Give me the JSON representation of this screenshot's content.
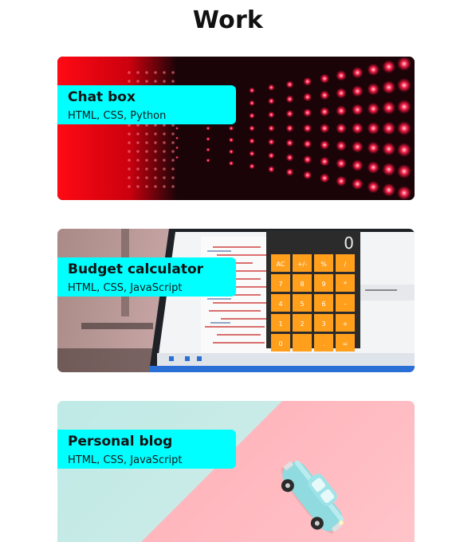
{
  "page": {
    "title": "Work"
  },
  "projects": [
    {
      "name": "Chat box",
      "tech": "HTML, CSS, Python",
      "image": "led-wall-photo"
    },
    {
      "name": "Budget calculator",
      "tech": "HTML, CSS, JavaScript",
      "image": "calculator-laptop-photo"
    },
    {
      "name": "Personal blog",
      "tech": "HTML, CSS, JavaScript",
      "image": "toy-car-photo"
    }
  ],
  "calculator": {
    "display": "0",
    "keys": [
      "AC",
      "+/-",
      "%",
      "/",
      "7",
      "8",
      "9",
      "*",
      "4",
      "5",
      "6",
      "-",
      "1",
      "2",
      "3",
      "+",
      "0",
      "",
      ".",
      "="
    ]
  },
  "colors": {
    "label_bg": "#00ffff",
    "led": "#ff1a3c",
    "calc_key": "#ff9f1c",
    "mint": "#bfeae6",
    "pink": "#ffb6bd"
  }
}
